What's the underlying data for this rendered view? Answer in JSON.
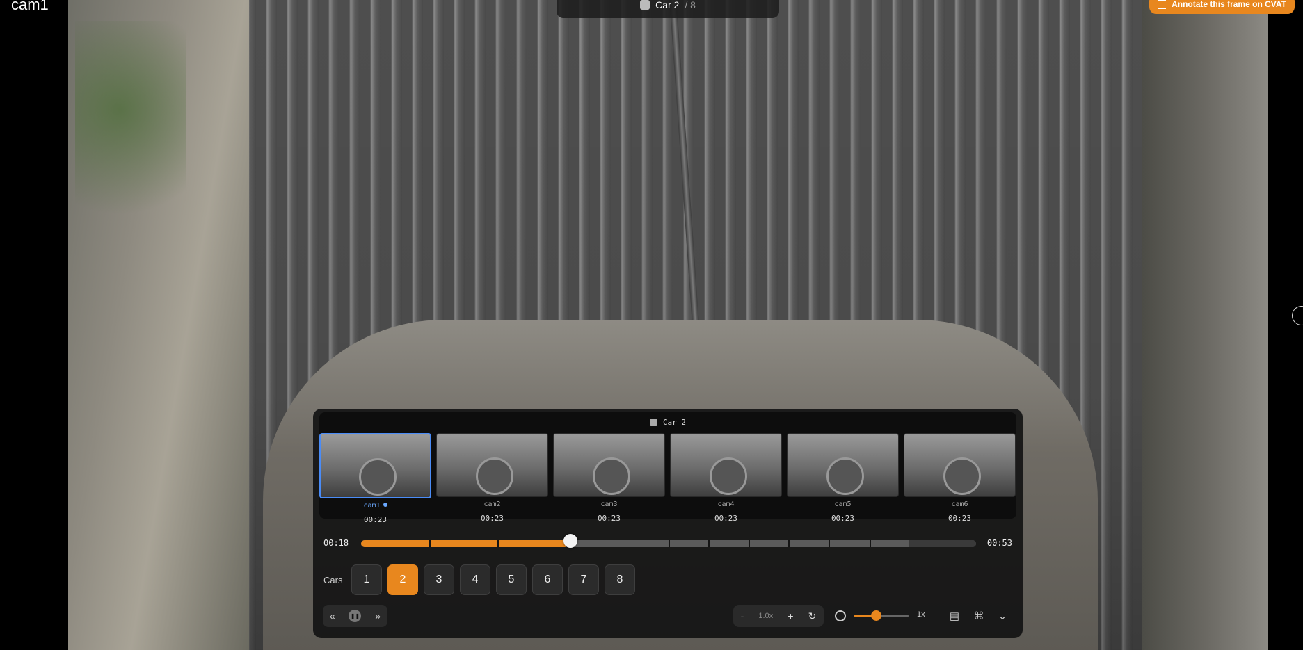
{
  "window": {
    "camera_label": "cam1"
  },
  "top_bar": {
    "car_label": "Car 2",
    "car_total": "/ 8"
  },
  "annotate_button": {
    "label": "Annotate this frame on CVAT"
  },
  "panel": {
    "car_header": "Car 2",
    "thumbnails": [
      {
        "name": "cam1",
        "time": "00:23",
        "active": true
      },
      {
        "name": "cam2",
        "time": "00:23",
        "active": false
      },
      {
        "name": "cam3",
        "time": "00:23",
        "active": false
      },
      {
        "name": "cam4",
        "time": "00:23",
        "active": false
      },
      {
        "name": "cam5",
        "time": "00:23",
        "active": false
      },
      {
        "name": "cam6",
        "time": "00:23",
        "active": false
      }
    ],
    "timeline": {
      "current": "00:18",
      "end": "00:53",
      "progress_fraction": 0.34,
      "buffered_fraction": 0.89
    },
    "cars": {
      "label": "Cars",
      "items": [
        "1",
        "2",
        "3",
        "4",
        "5",
        "6",
        "7",
        "8"
      ],
      "selected": "2"
    },
    "zoom": {
      "minus": "-",
      "value": "1.0x",
      "plus": "+"
    },
    "speed": {
      "value": "1x",
      "fraction": 0.4
    }
  },
  "colors": {
    "accent": "#e8871e",
    "selection": "#4a8cf7"
  }
}
